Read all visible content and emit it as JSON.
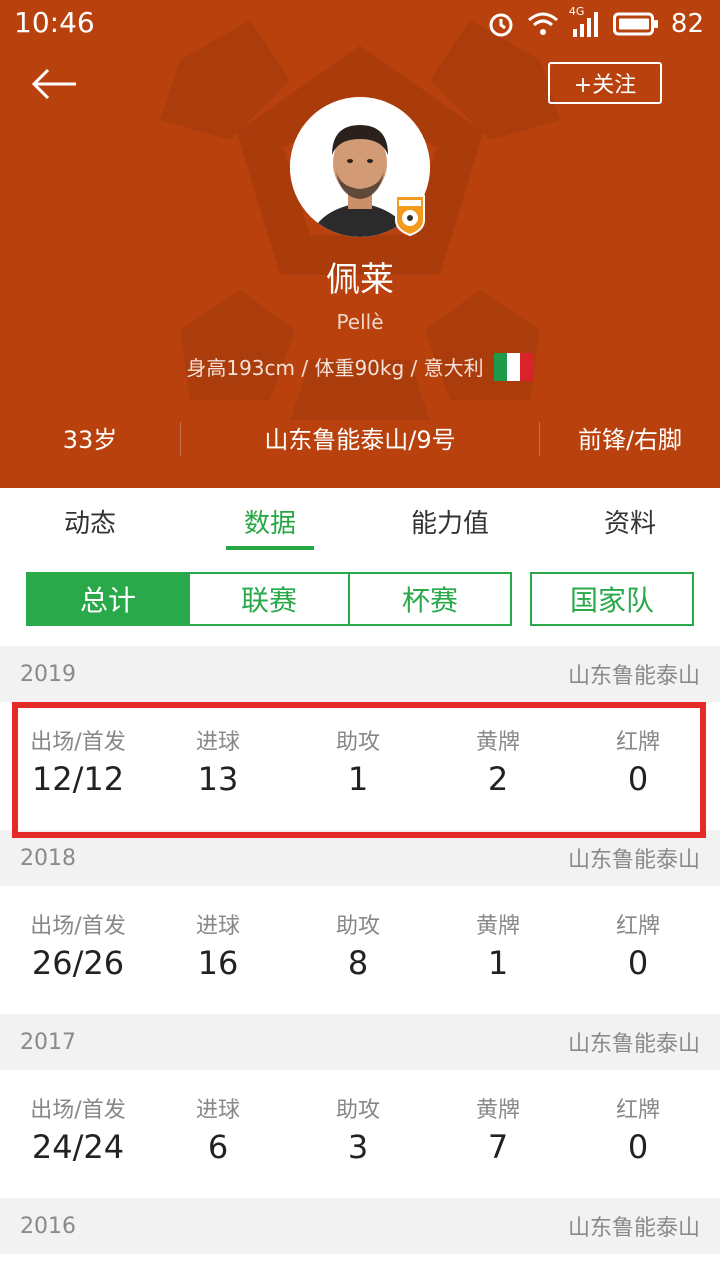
{
  "status_bar": {
    "time": "10:46",
    "battery": "82",
    "network": "4G"
  },
  "header": {
    "follow_label": "+关注",
    "name": "佩莱",
    "name_en": "Pellè",
    "info": "身高193cm / 体重90kg / 意大利",
    "age": "33岁",
    "club_number": "山东鲁能泰山/9号",
    "position_foot": "前锋/右脚",
    "colors": {
      "background": "#b9410d"
    },
    "flag_colors": [
      "#1e9a4a",
      "#ffffff",
      "#d8232a"
    ]
  },
  "tabs": [
    {
      "label": "动态",
      "active": false
    },
    {
      "label": "数据",
      "active": true
    },
    {
      "label": "能力值",
      "active": false
    },
    {
      "label": "资料",
      "active": false
    }
  ],
  "segments": [
    {
      "label": "总计",
      "active": true
    },
    {
      "label": "联赛",
      "active": false
    },
    {
      "label": "杯赛",
      "active": false
    },
    {
      "label": "国家队",
      "active": false
    }
  ],
  "stat_labels": [
    "出场/首发",
    "进球",
    "助攻",
    "黄牌",
    "红牌"
  ],
  "seasons": [
    {
      "year": "2019",
      "club": "山东鲁能泰山",
      "values": [
        "12/12",
        "13",
        "1",
        "2",
        "0"
      ]
    },
    {
      "year": "2018",
      "club": "山东鲁能泰山",
      "values": [
        "26/26",
        "16",
        "8",
        "1",
        "0"
      ]
    },
    {
      "year": "2017",
      "club": "山东鲁能泰山",
      "values": [
        "24/24",
        "6",
        "3",
        "7",
        "0"
      ]
    },
    {
      "year": "2016",
      "club": "山东鲁能泰山"
    }
  ],
  "accent_color": "#2aa94a",
  "highlight_color": "#e52a2a"
}
